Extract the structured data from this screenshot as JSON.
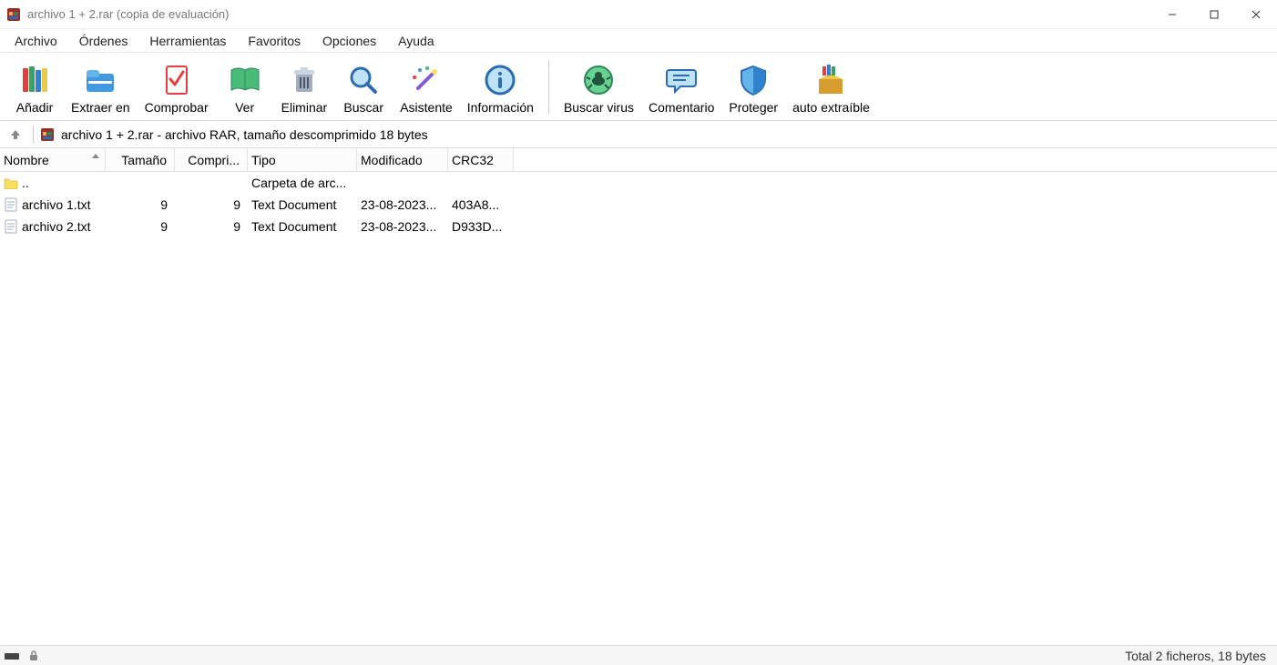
{
  "window": {
    "title": "archivo 1 + 2.rar (copia de evaluación)"
  },
  "menu": {
    "items": [
      "Archivo",
      "Órdenes",
      "Herramientas",
      "Favoritos",
      "Opciones",
      "Ayuda"
    ]
  },
  "toolbar": {
    "items": [
      {
        "label": "Añadir",
        "icon": "add"
      },
      {
        "label": "Extraer en",
        "icon": "extract"
      },
      {
        "label": "Comprobar",
        "icon": "test"
      },
      {
        "label": "Ver",
        "icon": "view"
      },
      {
        "label": "Eliminar",
        "icon": "delete"
      },
      {
        "label": "Buscar",
        "icon": "find"
      },
      {
        "label": "Asistente",
        "icon": "wizard"
      },
      {
        "label": "Información",
        "icon": "info"
      }
    ],
    "items2": [
      {
        "label": "Buscar virus",
        "icon": "virus"
      },
      {
        "label": "Comentario",
        "icon": "comment"
      },
      {
        "label": "Proteger",
        "icon": "protect"
      },
      {
        "label": "auto extraíble",
        "icon": "sfx"
      }
    ]
  },
  "path": {
    "text": "archivo 1 + 2.rar - archivo RAR, tamaño descomprimido 18 bytes"
  },
  "columns": {
    "name": "Nombre",
    "size": "Tamaño",
    "comp": "Compri...",
    "type": "Tipo",
    "mod": "Modificado",
    "crc": "CRC32"
  },
  "rows": [
    {
      "icon": "folder",
      "name": "..",
      "size": "",
      "comp": "",
      "type": "Carpeta de arc...",
      "mod": "",
      "crc": ""
    },
    {
      "icon": "doc",
      "name": "archivo 1.txt",
      "size": "9",
      "comp": "9",
      "type": "Text Document",
      "mod": "23-08-2023...",
      "crc": "403A8..."
    },
    {
      "icon": "doc",
      "name": "archivo 2.txt",
      "size": "9",
      "comp": "9",
      "type": "Text Document",
      "mod": "23-08-2023...",
      "crc": "D933D..."
    }
  ],
  "status": {
    "summary": "Total 2 ficheros, 18 bytes"
  }
}
